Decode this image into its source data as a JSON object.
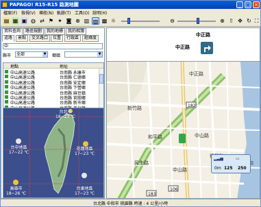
{
  "window": {
    "title": "PAPAGO! R15-R15 路測地圖"
  },
  "menu": [
    "檔案(F)",
    "檢視(V)",
    "導航(N)",
    "軌跡(T)",
    "工具(O)",
    "說明(H)"
  ],
  "left_panel": {
    "tabs_row1": [
      "資料查詢",
      "路徑規劃",
      "我的地標",
      "我的相簿"
    ],
    "tabs_row2": [
      "道路",
      "景點",
      "交叉路口",
      "位置",
      "行政區",
      "經緯度"
    ],
    "city_label": "縣市",
    "city_value": "全部",
    "district_label": "鄉鎮",
    "district_value": "",
    "search_value": "中",
    "list_headers": [
      "地點",
      "地址"
    ],
    "list_rows": [
      {
        "name": "中山高速公路",
        "addr": "台南縣 永康市"
      },
      {
        "name": "中山高速公路",
        "addr": "台南縣 仁德鄉"
      },
      {
        "name": "中山高速公路",
        "addr": "台南縣 安定鄉"
      },
      {
        "name": "中山高速公路",
        "addr": "台南縣 下營鄉"
      },
      {
        "name": "中山高速公路",
        "addr": "台南縣 麻豆鎮"
      },
      {
        "name": "中山高速公路",
        "addr": "台南縣 官田鄉"
      },
      {
        "name": "中山高速公路",
        "addr": "台南縣 新市鄉"
      },
      {
        "name": "中山高速公路",
        "addr": "台南縣 善化鎮"
      },
      {
        "name": "中山高速公路",
        "addr": "台南縣 新化鎮"
      }
    ],
    "weather": {
      "taipei": {
        "city": "台北市",
        "temp": "18~23 ℃"
      },
      "taichung": {
        "city": "台中地區",
        "temp": "17~22 ℃"
      },
      "hualien": {
        "city": "花蓮地區",
        "temp": "17~23 ℃"
      },
      "kaohsiung": {
        "city": "高雄市",
        "temp": "18~26 ℃"
      },
      "taitung": {
        "city": "台東地區",
        "temp": "17~23 ℃"
      }
    }
  },
  "navigation": {
    "current_road": "中正路",
    "next_road": "中正路"
  },
  "map": {
    "labels": [
      "中正路",
      "中山路",
      "新竹路",
      "和平路",
      "水和",
      "民生路",
      "中山路",
      "復興路"
    ],
    "route_numbers": [
      "182",
      "106",
      "183"
    ]
  },
  "gauge": {
    "zoom": "0m",
    "scale": "125",
    "value": "250"
  },
  "status": "台北縣 中和市    桃園縣    時速 : 4 公里/小時"
}
